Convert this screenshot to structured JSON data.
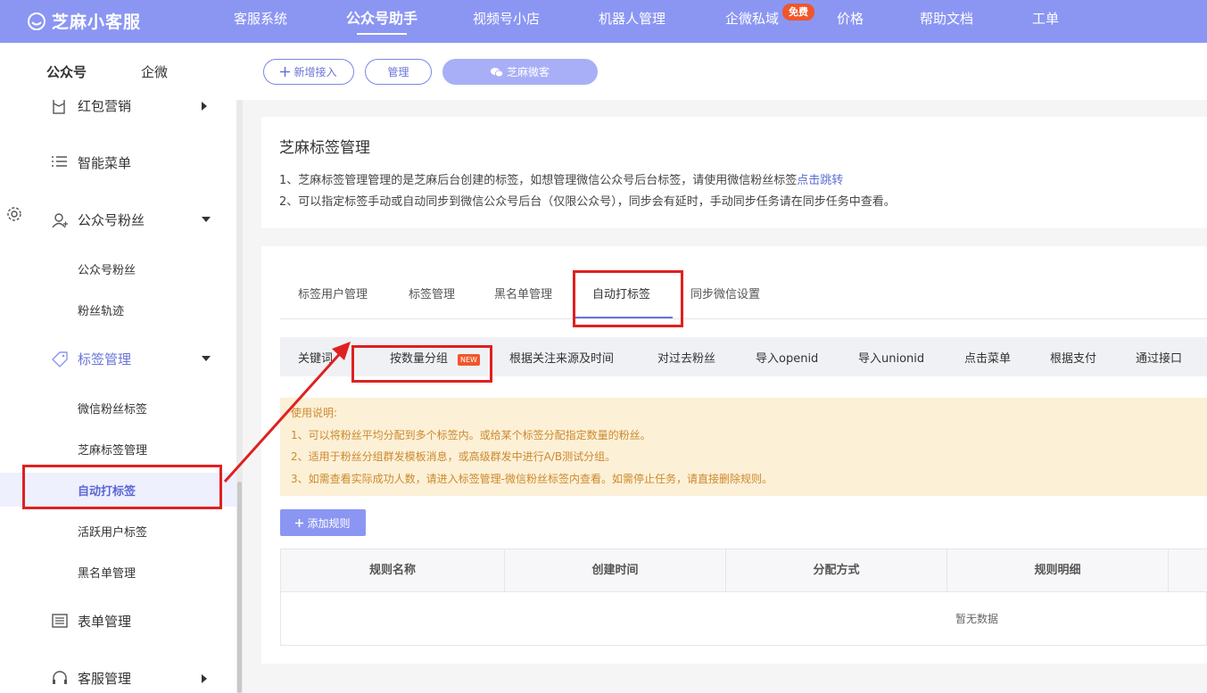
{
  "brand": {
    "name": "芝麻小客服"
  },
  "topnav": {
    "items": [
      "客服系统",
      "公众号助手",
      "视频号小店",
      "机器人管理",
      "企微私域",
      "价格",
      "帮助文档",
      "工单"
    ],
    "active": "公众号助手",
    "badge": "免费"
  },
  "subheader": {
    "tabs": [
      "公众号",
      "企微"
    ],
    "new_button": "新增接入",
    "manage_button": "管理",
    "account_button": "芝麻微客"
  },
  "sidebar": {
    "menus": {
      "red_packet": "红包营销",
      "smart_menu": "智能菜单",
      "fans": "公众号粉丝",
      "tags": "标签管理",
      "forms": "表单管理",
      "service": "客服管理"
    },
    "fans_sub": [
      "公众号粉丝",
      "粉丝轨迹"
    ],
    "tags_sub": [
      "微信粉丝标签",
      "芝麻标签管理",
      "自动打标签",
      "活跃用户标签",
      "黑名单管理"
    ],
    "active_sub": "自动打标签"
  },
  "info": {
    "title": "芝麻标签管理",
    "line1": "1、芝麻标签管理管理的是芝麻后台创建的标签，如想管理微信公众号后台标签，请使用微信粉丝标签",
    "line1_link": "点击跳转",
    "line2": "2、可以指定标签手动或自动同步到微信公众号后台（仅限公众号），同步会有延时，手动同步任务请在同步任务中查看。"
  },
  "tabs": [
    "标签用户管理",
    "标签管理",
    "黑名单管理",
    "自动打标签",
    "同步微信设置"
  ],
  "active_tab": "自动打标签",
  "subtabs": [
    "关键词",
    "按数量分组",
    "根据关注来源及时间",
    "对过去粉丝",
    "导入openid",
    "导入unionid",
    "点击菜单",
    "根据支付",
    "通过接口"
  ],
  "new_tag": "NEW",
  "notice": {
    "title": "使用说明:",
    "lines": [
      "1、可以将粉丝平均分配到多个标签内。或给某个标签分配指定数量的粉丝。",
      "2、适用于粉丝分组群发模板消息，或高级群发中进行A/B测试分组。",
      "3、如需查看实际成功人数，请进入标签管理-微信粉丝标签内查看。如需停止任务，请直接删除规则。"
    ]
  },
  "add_rule": "添加规则",
  "table": {
    "columns": [
      "规则名称",
      "创建时间",
      "分配方式",
      "规则明细"
    ],
    "empty": "暂无数据"
  },
  "colors": {
    "nav": "#8b96f3",
    "accent": "#6a74d9",
    "highlight": "#e02020",
    "notice_bg": "#fcf0d7",
    "notice_text": "#cc8a2e",
    "badge": "#f0562c"
  },
  "icons": [
    "logo-icon",
    "settings-gear-icon",
    "plus-icon",
    "wechat-icon",
    "red-packet-icon",
    "list-icon",
    "user-icon",
    "tag-icon",
    "form-icon",
    "headset-icon",
    "caret-down-icon",
    "caret-right-icon",
    "arrow-annotation"
  ]
}
